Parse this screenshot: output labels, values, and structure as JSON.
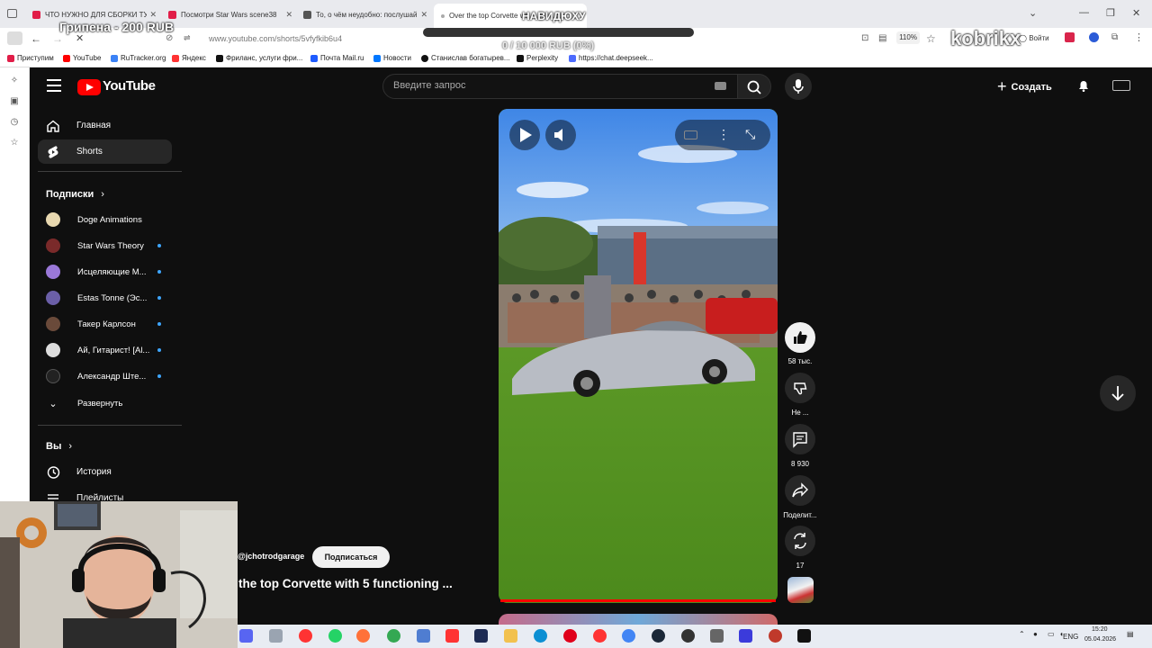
{
  "browser": {
    "tabs": [
      {
        "label": "ЧТО НУЖНО ДЛЯ СБОРКИ ТУ",
        "favicon_color": "#e11d48"
      },
      {
        "label": "Посмотри Star Wars scene38",
        "favicon_color": "#e11d48"
      },
      {
        "label": "То, о чём неудобно: послушай",
        "favicon_color": "#555555"
      },
      {
        "label": "Over the top Corvette wit",
        "favicon_color": "#aaaaaa"
      }
    ],
    "url": "www.youtube.com/shorts/5vfyfkib6u4",
    "zoom": "110%",
    "login_label": "Войти",
    "bookmarks": [
      {
        "label": "Приступим",
        "color": "#e11d48"
      },
      {
        "label": "YouTube",
        "color": "#ff0000"
      },
      {
        "label": "RuTracker.org",
        "color": "#3b82f6"
      },
      {
        "label": "Яндекс",
        "color": "#ff3333"
      },
      {
        "label": "Фриланс, услуги фри...",
        "color": "#111111"
      },
      {
        "label": "Почта Mail.ru",
        "color": "#1e5bff"
      },
      {
        "label": "Новости",
        "color": "#0077ff"
      },
      {
        "label": "Станислав богатырев...",
        "color": "#111111"
      },
      {
        "label": "Perplexity",
        "color": "#111111"
      },
      {
        "label": "https://chat.deepseek...",
        "color": "#4d6bfe"
      }
    ]
  },
  "overlays": {
    "donation_name": "Грипена - 200 RUB",
    "donation_progress": "0 / 10 000 RUB (0%)",
    "donation_goal": "НАВИДЮХУ",
    "streamer_logo": "kobrikx"
  },
  "youtube": {
    "logo_text": "YouTube",
    "search_placeholder": "Введите запрос",
    "create_label": "Создать",
    "nav": {
      "home": "Главная",
      "shorts": "Shorts",
      "subscriptions_title": "Подписки",
      "subscriptions": [
        {
          "name": "Doge Animations",
          "avatar_color": "#e8d8b0",
          "new": false
        },
        {
          "name": "Star Wars Theory",
          "avatar_color": "#7a2a2a",
          "new": true
        },
        {
          "name": "Исцеляющие М...",
          "avatar_color": "#9a78d8",
          "new": true
        },
        {
          "name": "Estas Tonne (Эс...",
          "avatar_color": "#6b5fa8",
          "new": true
        },
        {
          "name": "Такер Карлсон",
          "avatar_color": "#6a4a3a",
          "new": true
        },
        {
          "name": "Ай, Гитарист! [Al...",
          "avatar_color": "#dddddd",
          "new": true
        },
        {
          "name": "Александр Ште...",
          "avatar_color": "#222222",
          "new": true
        }
      ],
      "expand": "Развернуть",
      "you_title": "Вы",
      "history": "История",
      "playlists": "Плейлисты"
    },
    "short": {
      "channel": "@jchotrodgarage",
      "subscribe": "Подписаться",
      "title": "the top Corvette with 5 functioning ...",
      "likes": "58 тыс.",
      "dislike": "Не ...",
      "comments": "8 930",
      "share": "Поделит...",
      "remix": "17"
    }
  },
  "taskbar": {
    "lang": "ENG",
    "time": "15:20",
    "date": "05.04.2026",
    "apps": [
      {
        "name": "discord-icon",
        "color": "#5865f2"
      },
      {
        "name": "explorer-icon",
        "color": "#9aa4b1"
      },
      {
        "name": "yandex-icon",
        "color": "#ff3333"
      },
      {
        "name": "whatsapp-icon",
        "color": "#25d366"
      },
      {
        "name": "firefox-icon",
        "color": "#ff7139"
      },
      {
        "name": "chrome-icon",
        "color": "#34a853"
      },
      {
        "name": "app-icon",
        "color": "#4f7dd1"
      },
      {
        "name": "yandex-browser-icon",
        "color": "#ff3333"
      },
      {
        "name": "terminal-icon",
        "color": "#1d2b53"
      },
      {
        "name": "folder-icon",
        "color": "#f2c14e"
      },
      {
        "name": "edge-icon",
        "color": "#0c8fd3"
      },
      {
        "name": "opera-icon",
        "color": "#e0001b"
      },
      {
        "name": "yandex-alt-icon",
        "color": "#ff3333"
      },
      {
        "name": "chromium-icon",
        "color": "#4285f4"
      },
      {
        "name": "steam-icon",
        "color": "#1b2838"
      },
      {
        "name": "globe-icon",
        "color": "#333333"
      },
      {
        "name": "apps-icon",
        "color": "#666666"
      },
      {
        "name": "bold-icon",
        "color": "#3b3bdb"
      },
      {
        "name": "media-icon",
        "color": "#c0392b"
      },
      {
        "name": "console-icon",
        "color": "#111111"
      }
    ]
  },
  "colors": {
    "yt_red": "#ff0000",
    "unread_dot": "#3ea6ff",
    "bg": "#0f0f0f"
  }
}
